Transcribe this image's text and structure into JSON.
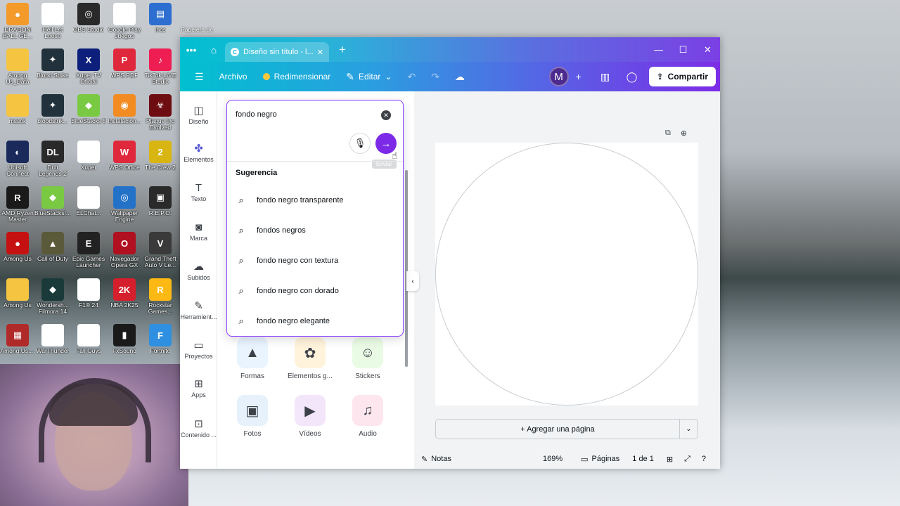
{
  "desktop": {
    "icons": [
      {
        "label": "DRAGON BALL GE...",
        "color": "#f39a2b",
        "glyph": "●"
      },
      {
        "label": "Hell Let Loose",
        "color": "#ffffff",
        "glyph": ""
      },
      {
        "label": "OBS Studio",
        "color": "#2a2a2a",
        "glyph": "◎"
      },
      {
        "label": "Google Play Juegos",
        "color": "#ffffff",
        "glyph": ""
      },
      {
        "label": "Inos",
        "color": "#2d6fd0",
        "glyph": "▤"
      },
      {
        "label": "Among Us_Data",
        "color": "#f5c542",
        "glyph": ""
      },
      {
        "label": "Blood Strike",
        "color": "#22323c",
        "glyph": "✦"
      },
      {
        "label": "Xuper TV Oficial",
        "color": "#0c1f7a",
        "glyph": "X"
      },
      {
        "label": "WPS PDF",
        "color": "#e0283c",
        "glyph": "P"
      },
      {
        "label": "TikTok LIVE Studio",
        "color": "#ee1d52",
        "glyph": "♪"
      },
      {
        "label": "mssok",
        "color": "#f5c542",
        "glyph": ""
      },
      {
        "label": "bloodstrik...",
        "color": "#22323c",
        "glyph": "✦"
      },
      {
        "label": "BlueStacks 5",
        "color": "#7ac943",
        "glyph": "◆"
      },
      {
        "label": "Instalación...",
        "color": "#f28b22",
        "glyph": "◉"
      },
      {
        "label": "Plague Inc Evolved",
        "color": "#6d0d12",
        "glyph": "☣"
      },
      {
        "label": "Ubisoft Connect",
        "color": "#1a2a5a",
        "glyph": "◐"
      },
      {
        "label": "Drift Legends 2",
        "color": "#2a2a2a",
        "glyph": "DL"
      },
      {
        "label": "Xuper",
        "color": "#ffffff",
        "glyph": ""
      },
      {
        "label": "WPS Office",
        "color": "#e0283c",
        "glyph": "W"
      },
      {
        "label": "The Crew 2",
        "color": "#d8b511",
        "glyph": "2"
      },
      {
        "label": "AMD Ryzen Master",
        "color": "#1a1a1a",
        "glyph": "R"
      },
      {
        "label": "BlueStacksI...",
        "color": "#7ac943",
        "glyph": "◆"
      },
      {
        "label": "ELChat...",
        "color": "#ffffff",
        "glyph": ""
      },
      {
        "label": "Wallpaper Engine",
        "color": "#2472c8",
        "glyph": "◎"
      },
      {
        "label": "R.E.P.O.",
        "color": "#2a2a2a",
        "glyph": "▣"
      },
      {
        "label": "Among Us",
        "color": "#c51111",
        "glyph": "●"
      },
      {
        "label": "Call of Duty",
        "color": "#5a5a3a",
        "glyph": "▲"
      },
      {
        "label": "Epic Games Launcher",
        "color": "#222222",
        "glyph": "E"
      },
      {
        "label": "Navegador Opera GX",
        "color": "#b01020",
        "glyph": "O"
      },
      {
        "label": "Grand Theft Auto V Le...",
        "color": "#3a3a3a",
        "glyph": "V"
      },
      {
        "label": "Among Us",
        "color": "#f5c542",
        "glyph": ""
      },
      {
        "label": "Wondersh... Filmora 14",
        "color": "#1a3a3a",
        "glyph": "◆"
      },
      {
        "label": "F1® 24",
        "color": "#ffffff",
        "glyph": ""
      },
      {
        "label": "NBA 2K25",
        "color": "#d61f2c",
        "glyph": "2K"
      },
      {
        "label": "Rockstar Games...",
        "color": "#fcb813",
        "glyph": "R"
      },
      {
        "label": "Among.Us....",
        "color": "#b02a2a",
        "glyph": "▦"
      },
      {
        "label": "WarThunder",
        "color": "#ffffff",
        "glyph": ""
      },
      {
        "label": "Fall Guys",
        "color": "#ffffff",
        "glyph": ""
      },
      {
        "label": "FxSound",
        "color": "#1a1a1a",
        "glyph": "▮"
      },
      {
        "label": "Fortnite",
        "color": "#2f8fe0",
        "glyph": "F"
      }
    ],
    "recycle_bin": "Papelera de"
  },
  "browser": {
    "tab_title": "Diseño sin título - l...",
    "tab_favicon": "C"
  },
  "toolbar": {
    "menu_icon": "☰",
    "archivo": "Archivo",
    "redimensionar": "Redimensionar",
    "editar": "Editar",
    "avatar_initial": "M",
    "share_label": "Compartir"
  },
  "rail": [
    {
      "label": "Diseño",
      "icon": "◫"
    },
    {
      "label": "Elementos",
      "icon": "✤"
    },
    {
      "label": "Texto",
      "icon": "T"
    },
    {
      "label": "Marca",
      "icon": "◙"
    },
    {
      "label": "Subidos",
      "icon": "☁"
    },
    {
      "label": "Herramient...",
      "icon": "✎"
    },
    {
      "label": "Proyectos",
      "icon": "▭"
    },
    {
      "label": "Apps",
      "icon": "⊞"
    },
    {
      "label": "Contenido ...",
      "icon": "⊡"
    }
  ],
  "search": {
    "value": "fondo negro",
    "tooltip": "Enviar",
    "suggestions_title": "Sugerencia",
    "suggestions": [
      "fondo negro transparente",
      "fondos negros",
      "fondo negro con textura",
      "fondo negro con dorado",
      "fondo negro elegante"
    ]
  },
  "categories": [
    {
      "label": "Formas",
      "color": "#e9f4ff",
      "glyph": "▲"
    },
    {
      "label": "Elementos g...",
      "color": "#fff3dc",
      "glyph": "✿"
    },
    {
      "label": "Stickers",
      "color": "#eafbe5",
      "glyph": "☺"
    },
    {
      "label": "Fotos",
      "color": "#e6f1fb",
      "glyph": "▣"
    },
    {
      "label": "Vídeos",
      "color": "#f3e6fb",
      "glyph": "▶"
    },
    {
      "label": "Audio",
      "color": "#fde6ee",
      "glyph": "♫"
    }
  ],
  "canvas": {
    "add_page": "+ Agregar una página"
  },
  "statusbar": {
    "notes": "Notas",
    "zoom": "169%",
    "pages": "Páginas",
    "page_count": "1 de 1"
  }
}
